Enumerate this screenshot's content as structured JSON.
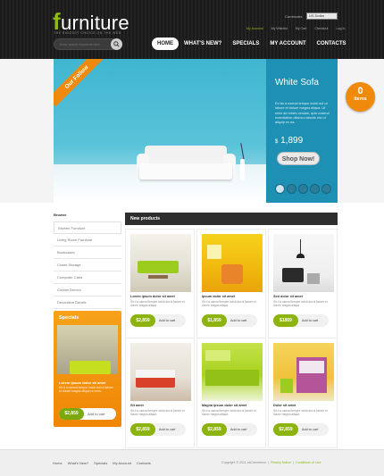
{
  "header": {
    "logo_first": "f",
    "logo_rest": "urniture",
    "tagline": "THE BIGGEST CHOICE ON THE WEB",
    "currency_label": "Currencies",
    "currency_value": "US Dollar",
    "toplinks": [
      "My Account",
      "My Wishlist",
      "My Cart",
      "Checkout",
      "Log In"
    ],
    "search_placeholder": "Enter search keywords here",
    "nav": [
      "HOME",
      "WHAT'S NEW?",
      "SPECIALS",
      "MY ACCOUNT",
      "CONTACTS"
    ]
  },
  "banner": {
    "ribbon": "Our Follow",
    "title": "White Sofa",
    "description": "Ed do a usmod tempor incidi dut ut labore et dolore magna aliqua. Ut enim ad minim veniam, quis nostrud exercitation ullamco laboris nisi ut aliquip ex ea.",
    "price": "1,899",
    "currency": "$",
    "button": "Shop Now!",
    "slides": 5,
    "active_slide": 0,
    "accent": "#1d90b3"
  },
  "cart": {
    "count": "0",
    "label": "items",
    "color": "#f08a0c"
  },
  "sidebar": {
    "title": "Browse",
    "items": [
      "Kitchen Furniture",
      "Living Room Furniture",
      "Bookcases",
      "Closet Storage",
      "Computer Carts",
      "Curtain Decors",
      "Decorative Details"
    ]
  },
  "specials": {
    "title": "Specials",
    "name": "Lorem ipsum dolor sit amet",
    "desc": "Sit d a usmod tempor incidi dut ut labore et dolore magna aliqua ut enim.",
    "price": "$2,859",
    "add": "Add to cart"
  },
  "products": {
    "title": "New products",
    "items": [
      {
        "name": "Lorem ipsum dolor sit amet",
        "desc": "Sit d a usmod tempor incidi dut ut labore et dolore magna aliqua.",
        "price": "$2,859",
        "add": "Add to cart"
      },
      {
        "name": "Ipsum dolor sit amet",
        "desc": "Sit d a usmod tempor incidi dut ut labore et dolore magna aliqua.",
        "price": "$1,859",
        "add": "Add to cart"
      },
      {
        "name": "Sed dolor sit amet",
        "desc": "Sit d a usmod tempor incidi dut ut labore et dolore magna aliqua.",
        "price": "$1859",
        "add": "Add to cart"
      },
      {
        "name": "Sit amet",
        "desc": "Sit d a usmod tempor incidi dut ut labore et dolore magna aliqua.",
        "price": "$2,859",
        "add": "Add to cart"
      },
      {
        "name": "Magna ipsum dolor sit amet",
        "desc": "Sit d a usmod tempor incidi dut ut labore et dolore magna aliqua.",
        "price": "$2,859",
        "add": "Add to cart"
      },
      {
        "name": "Dolor sit amet",
        "desc": "Sit d a usmod tempor incidi dut ut labore et dolore magna aliqua.",
        "price": "$2,859",
        "add": "Add to cart"
      }
    ]
  },
  "footer": {
    "links": [
      "Home",
      "What's New?",
      "Specials",
      "My Account",
      "Contacts"
    ],
    "copyright": "Copyright © 2011 osCommerce",
    "privacy": "Privacy Notice",
    "conditions": "Conditions of Use"
  }
}
